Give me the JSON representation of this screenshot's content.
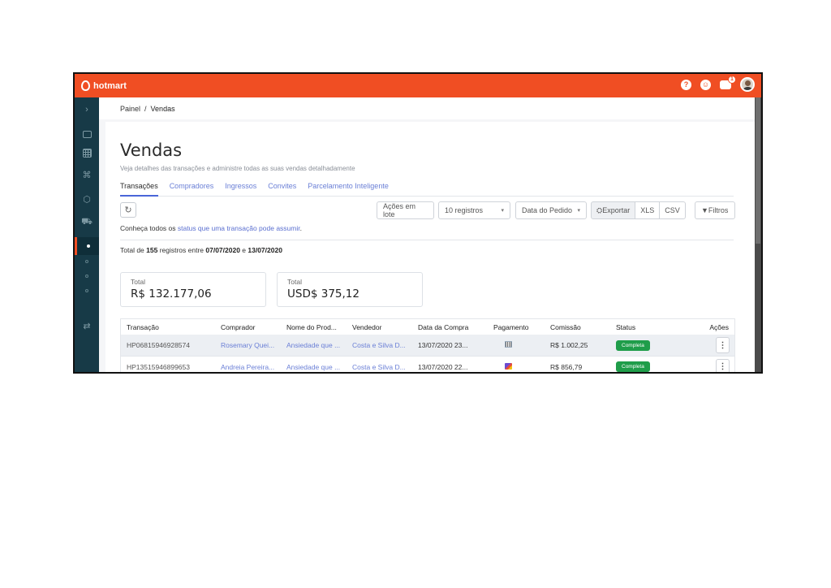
{
  "topbar": {
    "brand": "hotmart",
    "help_icon": "question-circle-icon",
    "support_icon": "headset-icon",
    "notifications_icon": "chat-bubble-icon",
    "notifications_count": "1",
    "brand_color": "#f04e23"
  },
  "sidebar": {
    "expand_icon": "chevron-right-icon",
    "items": [
      {
        "icon": "id-card-icon"
      },
      {
        "icon": "grid-icon"
      },
      {
        "icon": "network-icon"
      },
      {
        "icon": "cube-icon"
      },
      {
        "icon": "cart-icon"
      },
      {
        "icon": "dot-icon"
      },
      {
        "icon": "dot-icon"
      },
      {
        "icon": "dot-icon"
      },
      {
        "icon": "dot-icon"
      },
      {
        "icon": "swap-icon"
      }
    ]
  },
  "breadcrumb": {
    "root": "Painel",
    "separator": "/",
    "current": "Vendas"
  },
  "page": {
    "title": "Vendas",
    "subtitle": "Veja detalhes das transações e administre todas as suas vendas detalhadamente"
  },
  "tabs": [
    "Transações",
    "Compradores",
    "Ingressos",
    "Convites",
    "Parcelamento Inteligente"
  ],
  "toolbar": {
    "bulk_actions": "Ações em lote",
    "records_select": "10 registros",
    "date_select": "Data do Pedido",
    "export": "Exportar",
    "xls": "XLS",
    "csv": "CSV",
    "filters": "Filtros"
  },
  "info": {
    "status_prefix": "Conheça todos os ",
    "status_link": "status que uma transação pode assumir",
    "status_suffix": ".",
    "records_prefix": "Total de ",
    "records_count": "155",
    "records_mid": " registros entre ",
    "date_from": "07/07/2020",
    "records_and": " e ",
    "date_to": "13/07/2020"
  },
  "totals": [
    {
      "label": "Total",
      "value": "R$ 132.177,06"
    },
    {
      "label": "Total",
      "value": "USD$ 375,12"
    }
  ],
  "table": {
    "headers": [
      "Transação",
      "Comprador",
      "Nome do Prod...",
      "Vendedor",
      "Data da Compra",
      "Pagamento",
      "Comissão",
      "Status",
      "Ações"
    ],
    "rows": [
      {
        "transaction": "HP06815946928574",
        "buyer": "Rosemary Quei...",
        "product": "Ansiedade que ...",
        "seller": "Costa e Silva D...",
        "date": "13/07/2020 23...",
        "payment_icon": "boleto-icon",
        "commission": "R$ 1.002,25",
        "status": "Completa"
      },
      {
        "transaction": "HP13515946899653",
        "buyer": "Andreia Pereira...",
        "product": "Ansiedade que ...",
        "seller": "Costa e Silva D...",
        "date": "13/07/2020 22...",
        "payment_icon": "credit-card-icon",
        "commission": "R$ 856,79",
        "status": "Completa"
      }
    ]
  },
  "status_color": "#1f9d4a",
  "link_color": "#6a7fd6"
}
